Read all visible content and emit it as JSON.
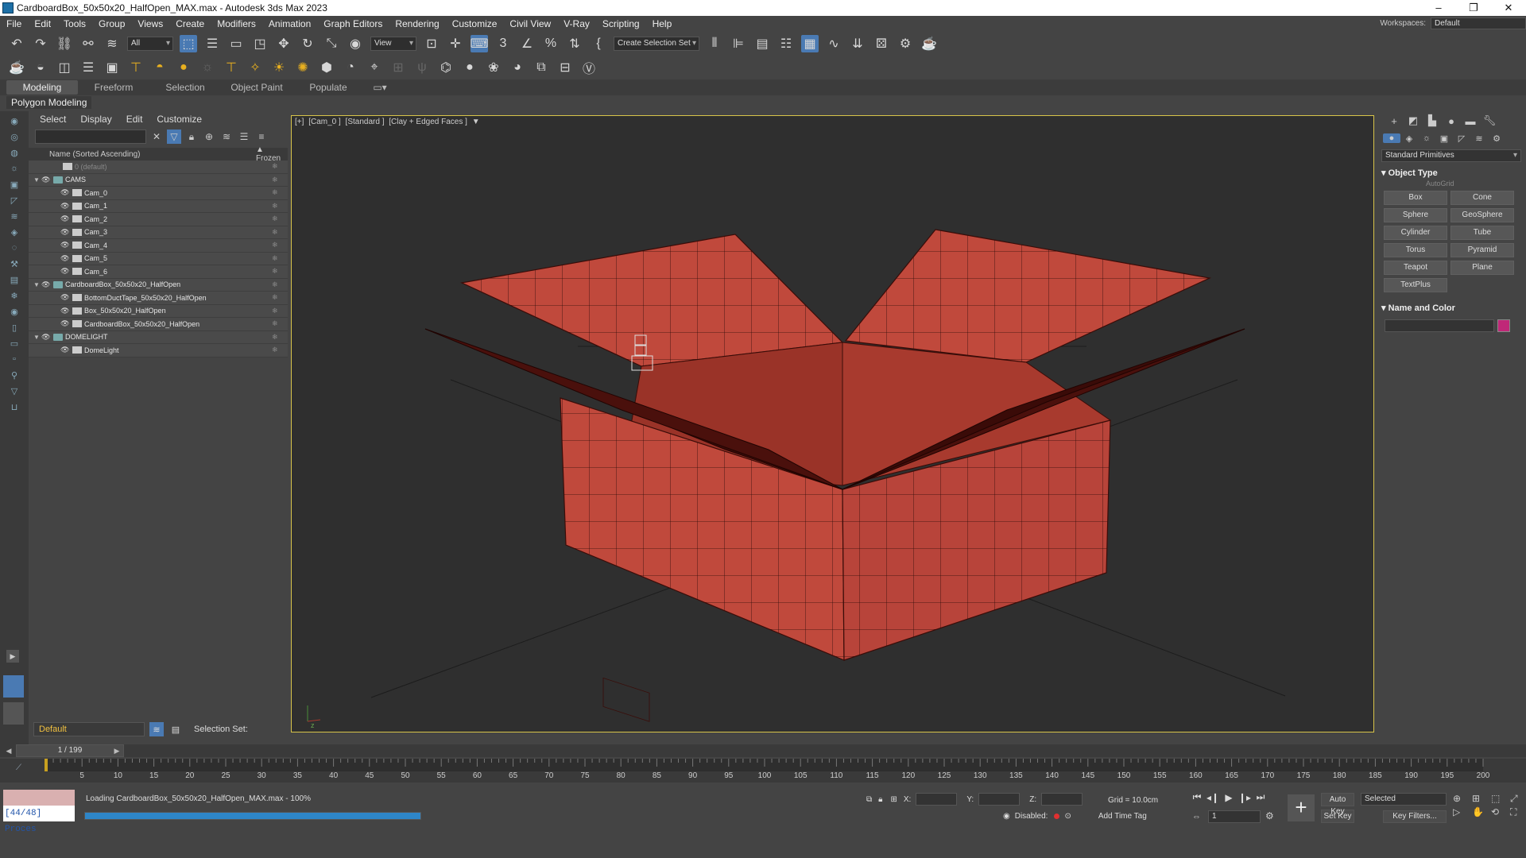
{
  "window": {
    "title": "CardboardBox_50x50x20_HalfOpen_MAX.max - Autodesk 3ds Max 2023"
  },
  "menu": [
    "File",
    "Edit",
    "Tools",
    "Group",
    "Views",
    "Create",
    "Modifiers",
    "Animation",
    "Graph Editors",
    "Rendering",
    "Customize",
    "Civil View",
    "V-Ray",
    "Scripting",
    "Help"
  ],
  "workspaces": {
    "label": "Workspaces:",
    "value": "Default"
  },
  "toolbar": {
    "filter": "All",
    "refcoord": "View",
    "selection_set": "Create Selection Set"
  },
  "ribbon": {
    "tabs": [
      "Modeling",
      "Freeform",
      "Selection",
      "Object Paint",
      "Populate"
    ],
    "sub": "Polygon Modeling"
  },
  "explorer": {
    "menu": [
      "Select",
      "Display",
      "Edit",
      "Customize"
    ],
    "col_name": "Name (Sorted Ascending)",
    "col_frozen": "▲ Frozen",
    "rows": [
      {
        "label": "0 (default)",
        "indent": 1,
        "dim": true
      },
      {
        "label": "CAMS",
        "indent": 0
      },
      {
        "label": "Cam_0",
        "indent": 2
      },
      {
        "label": "Cam_1",
        "indent": 2
      },
      {
        "label": "Cam_2",
        "indent": 2
      },
      {
        "label": "Cam_3",
        "indent": 2
      },
      {
        "label": "Cam_4",
        "indent": 2
      },
      {
        "label": "Cam_5",
        "indent": 2
      },
      {
        "label": "Cam_6",
        "indent": 2
      },
      {
        "label": "CardboardBox_50x50x20_HalfOpen",
        "indent": 0
      },
      {
        "label": "BottomDuctTape_50x50x20_HalfOpen",
        "indent": 2
      },
      {
        "label": "Box_50x50x20_HalfOpen",
        "indent": 2
      },
      {
        "label": "CardboardBox_50x50x20_HalfOpen",
        "indent": 2
      },
      {
        "label": "DOMELIGHT",
        "indent": 0
      },
      {
        "label": "DomeLight",
        "indent": 2
      }
    ],
    "layer": "Default",
    "selection_set": "Selection Set:"
  },
  "viewport": {
    "labels": [
      "[+]",
      "[Cam_0 ]",
      "[Standard ]",
      "[Clay + Edged Faces ]"
    ],
    "box_color": "#c0493c"
  },
  "command_panel": {
    "category": "Standard Primitives",
    "object_type": "Object Type",
    "autogrid": "AutoGrid",
    "buttons": [
      "Box",
      "Cone",
      "Sphere",
      "GeoSphere",
      "Cylinder",
      "Tube",
      "Torus",
      "Pyramid",
      "Teapot",
      "Plane",
      "TextPlus"
    ],
    "name_color": "Name and Color",
    "color": "#c02878"
  },
  "timeline": {
    "frame": "1 / 199",
    "ticks": [
      "5",
      "10",
      "15",
      "20",
      "25",
      "30",
      "35",
      "40",
      "45",
      "50",
      "55",
      "60",
      "65",
      "70",
      "75",
      "80",
      "85",
      "90",
      "95",
      "100",
      "105",
      "110",
      "115",
      "120",
      "125",
      "130",
      "135",
      "140",
      "145",
      "150",
      "155",
      "160",
      "165",
      "170",
      "175",
      "180",
      "185",
      "190",
      "195",
      "200"
    ]
  },
  "status": {
    "maxscript": "[44/48] Proces",
    "loading": "Loading CardboardBox_50x50x20_HalfOpen_MAX.max  -  100%",
    "progress": 1.0,
    "x": "X:",
    "y": "Y:",
    "z": "Z:",
    "grid": "Grid = 10.0cm",
    "disabled": "Disabled:",
    "add_time_tag": "Add Time Tag",
    "frame": "1",
    "auto_key": "Auto Key",
    "set_key": "Set Key",
    "key_mode": "Selected",
    "key_filters": "Key Filters..."
  }
}
